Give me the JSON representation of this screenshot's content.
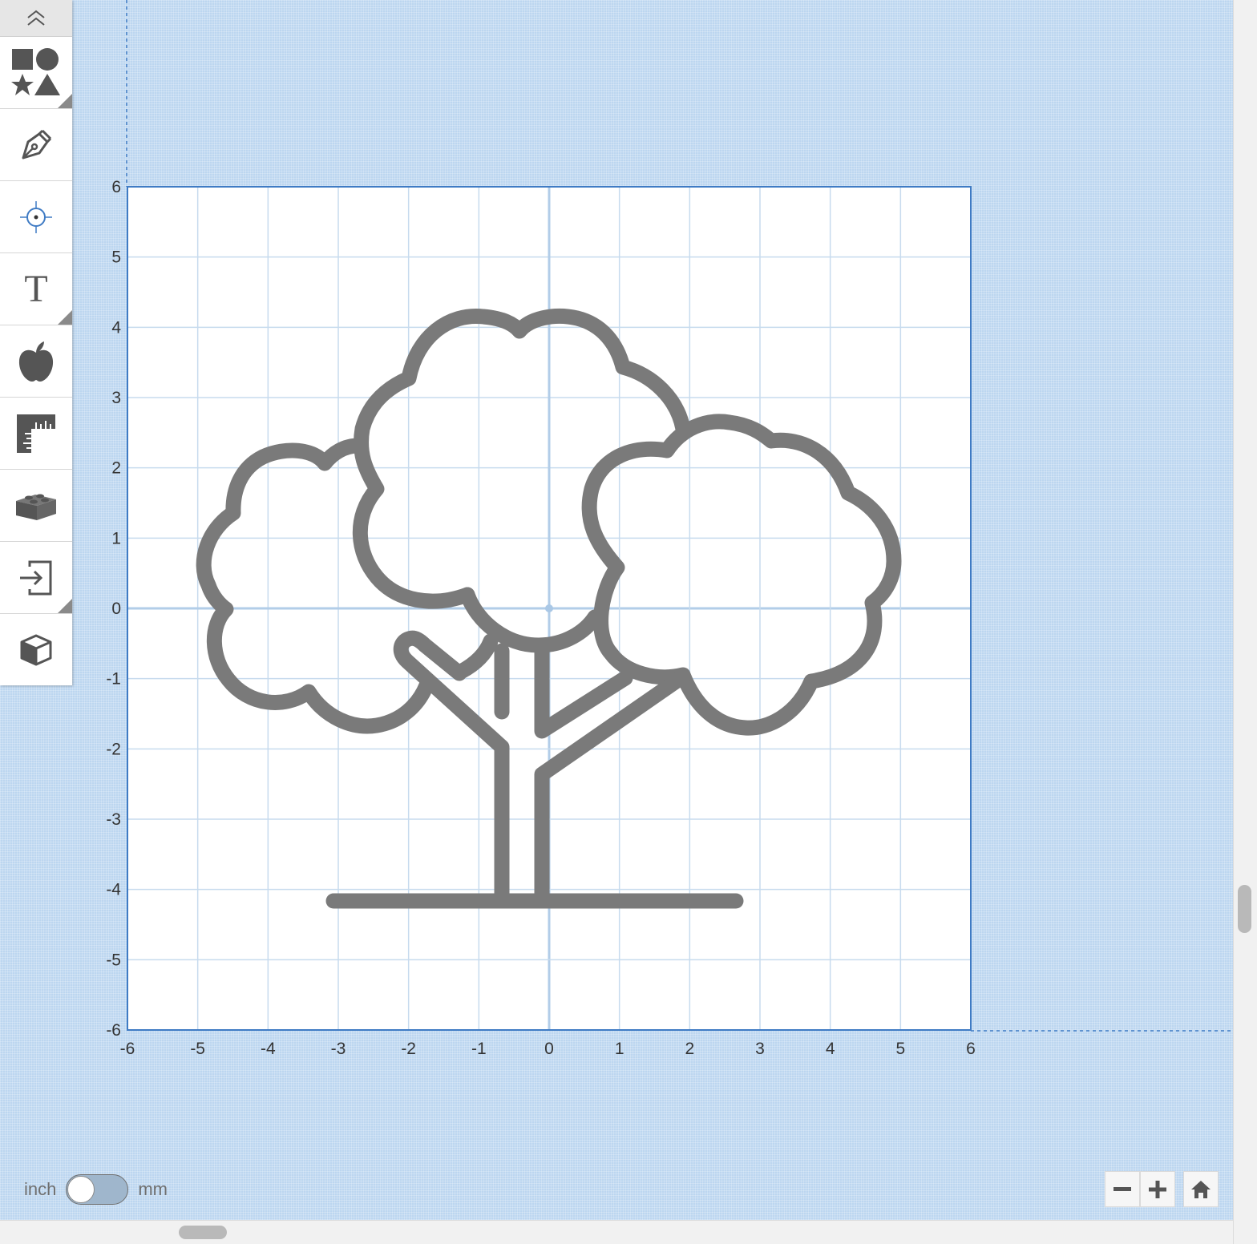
{
  "canvas": {
    "grid_range": {
      "min": -6,
      "max": 6,
      "step": 1
    },
    "x_tick_labels": [
      "-6",
      "-5",
      "-4",
      "-3",
      "-2",
      "-1",
      "0",
      "1",
      "2",
      "3",
      "4",
      "5",
      "6"
    ],
    "y_tick_labels": [
      "6",
      "5",
      "4",
      "3",
      "2",
      "1",
      "0",
      "-1",
      "-2",
      "-3",
      "-4",
      "-5",
      "-6"
    ],
    "drawing": {
      "name": "tree",
      "stroke_color": "#7a7a7a"
    },
    "colors": {
      "workspace_bg": "#bcd6f0",
      "grid_line": "#c7dbee",
      "grid_axis": "#b2cde8",
      "border": "#3f7bc4",
      "tick_text": "#333333"
    }
  },
  "toolbar": {
    "collapse_icon": "chevron-double-up-icon",
    "items": [
      {
        "id": "shapes",
        "icon": "shapes-icon",
        "has_submenu": true
      },
      {
        "id": "pen",
        "icon": "pen-icon",
        "has_submenu": false
      },
      {
        "id": "origin",
        "icon": "crosshair-icon",
        "has_submenu": false
      },
      {
        "id": "text",
        "icon": "text-icon",
        "label": "T",
        "has_submenu": true
      },
      {
        "id": "shape-library",
        "icon": "apple-icon",
        "has_submenu": false
      },
      {
        "id": "ruler",
        "icon": "ruler-icon",
        "has_submenu": false
      },
      {
        "id": "blocks",
        "icon": "brick-icon",
        "has_submenu": false
      },
      {
        "id": "import",
        "icon": "import-icon",
        "has_submenu": true
      },
      {
        "id": "view-3d",
        "icon": "cube-icon",
        "has_submenu": false
      }
    ]
  },
  "units": {
    "left_label": "inch",
    "right_label": "mm",
    "selected": "inch"
  },
  "zoom": {
    "out_icon": "minus-icon",
    "in_icon": "plus-icon",
    "home_icon": "home-icon"
  }
}
